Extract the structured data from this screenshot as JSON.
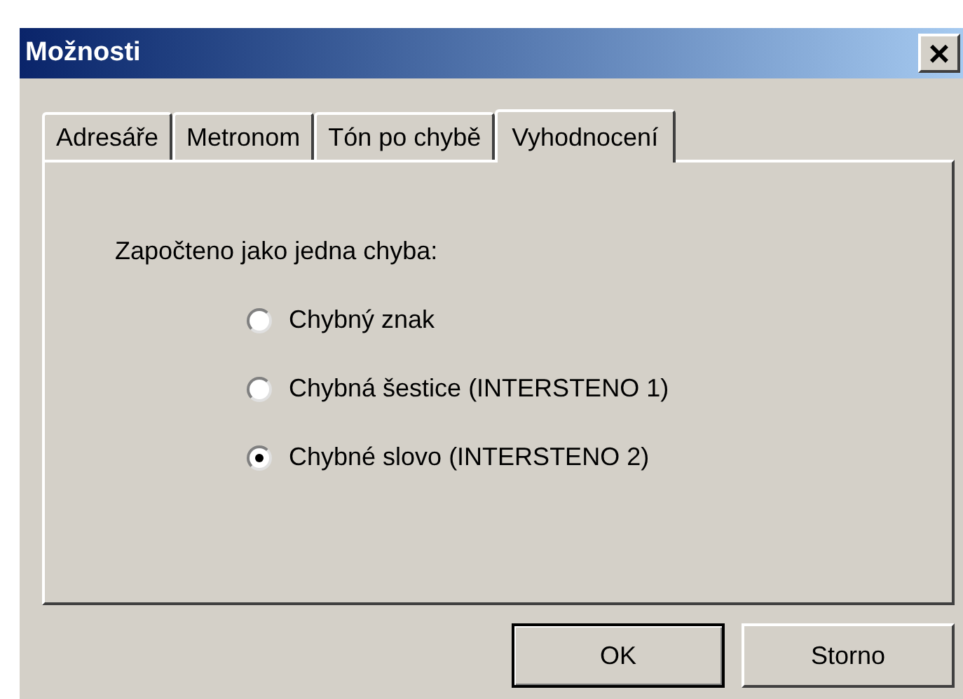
{
  "window": {
    "title": "Možnosti",
    "close": "×"
  },
  "tabs": [
    {
      "label": "Adresáře",
      "selected": false
    },
    {
      "label": "Metronom",
      "selected": false
    },
    {
      "label": "Tón po chybě",
      "selected": false
    },
    {
      "label": "Vyhodnocení",
      "selected": true
    }
  ],
  "group_label": "Započteno jako jedna chyba:",
  "options": [
    {
      "label": "Chybný znak",
      "selected": false
    },
    {
      "label": "Chybná šestice (INTERSTENO 1)",
      "selected": false
    },
    {
      "label": "Chybné slovo (INTERSTENO 2)",
      "selected": true
    }
  ],
  "buttons": [
    {
      "label": "OK",
      "default": true
    },
    {
      "label": "Storno",
      "default": false
    }
  ]
}
